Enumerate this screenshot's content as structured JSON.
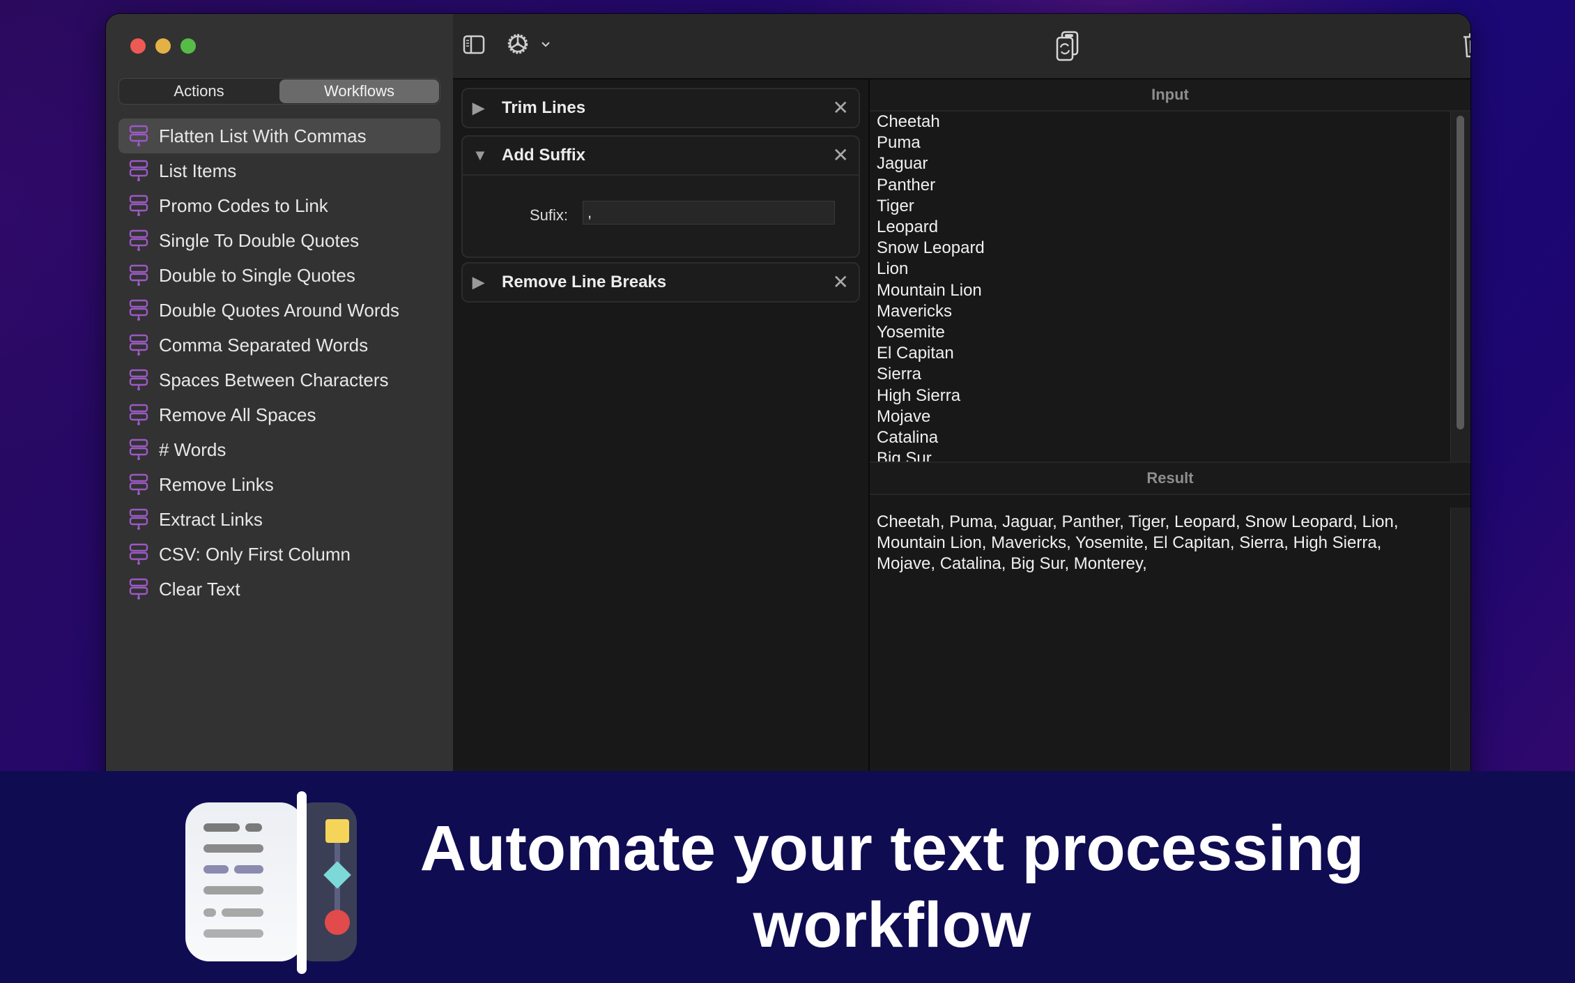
{
  "window": {
    "sidebar": {
      "segments": [
        {
          "label": "Actions",
          "active": false
        },
        {
          "label": "Workflows",
          "active": true
        }
      ],
      "items": [
        {
          "label": "Flatten List With Commas",
          "selected": true
        },
        {
          "label": "List Items"
        },
        {
          "label": "Promo Codes to Link"
        },
        {
          "label": "Single To Double Quotes"
        },
        {
          "label": "Double to Single Quotes"
        },
        {
          "label": "Double Quotes Around Words"
        },
        {
          "label": "Comma Separated Words"
        },
        {
          "label": "Spaces Between Characters"
        },
        {
          "label": "Remove All Spaces"
        },
        {
          "label": "# Words"
        },
        {
          "label": "Remove Links"
        },
        {
          "label": "Extract Links"
        },
        {
          "label": "CSV: Only First Column"
        },
        {
          "label": "Clear Text"
        }
      ],
      "item_icon": "workflow-icon",
      "icon_color": "#9b59c4"
    },
    "toolbar": {
      "left_icons": [
        "sidebar-toggle-icon",
        "gear-icon",
        "chevron-down-icon"
      ],
      "center_icon": "copy-convert-icon",
      "right_icons": [
        "trash-icon",
        "share-icon",
        "chevron-down-icon"
      ]
    },
    "workflow_steps": [
      {
        "title": "Trim Lines",
        "expanded": false
      },
      {
        "title": "Add Suffix",
        "expanded": true,
        "field_label": "Sufix:",
        "field_value": ","
      },
      {
        "title": "Remove Line Breaks",
        "expanded": false
      }
    ],
    "input": {
      "header": "Input",
      "lines": [
        "Cheetah",
        "Puma",
        "Jaguar",
        "Panther",
        "Tiger",
        "Leopard",
        "Snow Leopard",
        "Lion",
        "Mountain Lion",
        "Mavericks",
        "Yosemite",
        "El Capitan",
        "Sierra",
        "High Sierra",
        "Mojave",
        "Catalina",
        "Big Sur"
      ]
    },
    "result": {
      "header": "Result",
      "text": "Cheetah, Puma, Jaguar, Panther, Tiger, Leopard, Snow Leopard, Lion, Mountain Lion, Mavericks, Yosemite, El Capitan, Sierra, High Sierra, Mojave, Catalina, Big Sur, Monterey,"
    }
  },
  "banner": {
    "headline": "Automate your text processing workflow",
    "app_icon": "text-workflow-app-icon",
    "colors": {
      "background": "#100c52",
      "yellow": "#f5d45a",
      "teal": "#7dd8d8",
      "red": "#e24b4b"
    }
  }
}
